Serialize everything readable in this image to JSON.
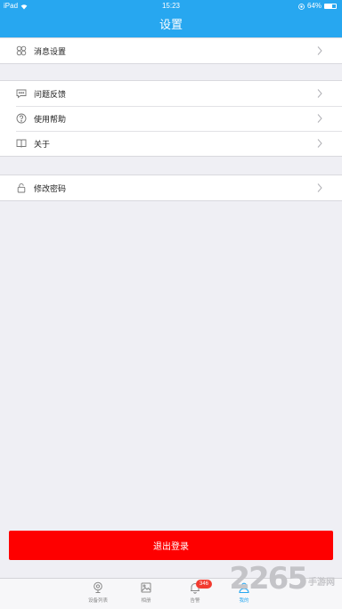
{
  "status_bar": {
    "carrier": "iPad",
    "time": "15:23",
    "battery": "64%",
    "battery_level": 0.64
  },
  "header": {
    "title": "设置"
  },
  "groups": [
    {
      "items": [
        {
          "label": "消息设置",
          "icon": "flower-icon"
        }
      ]
    },
    {
      "items": [
        {
          "label": "问题反馈",
          "icon": "chat-bubble-icon"
        },
        {
          "label": "使用帮助",
          "icon": "question-icon"
        },
        {
          "label": "关于",
          "icon": "book-icon"
        }
      ]
    },
    {
      "items": [
        {
          "label": "修改密码",
          "icon": "lock-icon"
        }
      ]
    }
  ],
  "logout_label": "退出登录",
  "tabbar": {
    "tabs": [
      {
        "label": "设备列表",
        "icon": "camera-icon",
        "active": false
      },
      {
        "label": "相册",
        "icon": "photo-icon",
        "active": false
      },
      {
        "label": "告警",
        "icon": "bell-icon",
        "active": false,
        "badge": "346"
      },
      {
        "label": "我的",
        "icon": "user-icon",
        "active": true
      }
    ]
  },
  "colors": {
    "accent": "#27a7f0",
    "danger": "#fe0000",
    "badge": "#f23a2f"
  },
  "watermark": {
    "number": "2265",
    "text": "手游网"
  }
}
